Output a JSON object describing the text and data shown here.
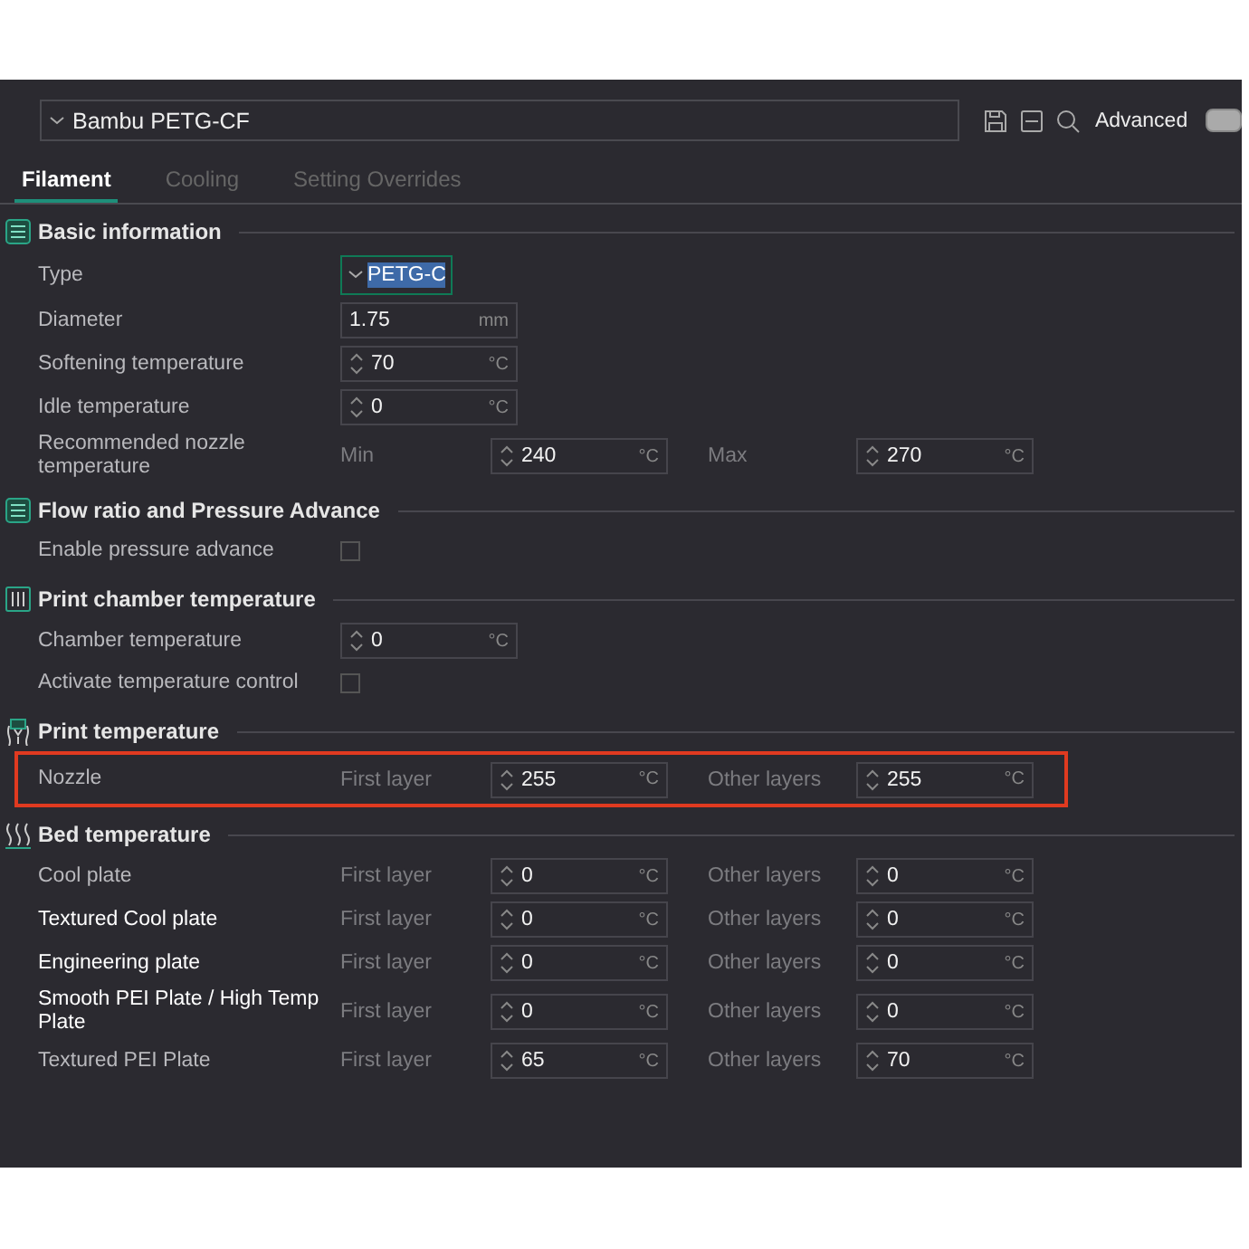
{
  "preset": {
    "value": "Bambu PETG-CF"
  },
  "toolbar": {
    "advanced_label": "Advanced",
    "advanced_on": false
  },
  "tabs": [
    {
      "label": "Filament",
      "selected": true
    },
    {
      "label": "Cooling",
      "selected": false
    },
    {
      "label": "Setting Overrides",
      "selected": false
    }
  ],
  "sections": [
    {
      "title": "Basic information",
      "rows": [
        {
          "kind": "combo",
          "label": "Type",
          "modified": false,
          "value": "PETG-C",
          "focused": true
        },
        {
          "kind": "field",
          "label": "Diameter",
          "modified": false,
          "value": "1.75",
          "unit": "mm",
          "spinner": false
        },
        {
          "kind": "field",
          "label": "Softening temperature",
          "modified": false,
          "value": "70",
          "unit": "°C",
          "spinner": true
        },
        {
          "kind": "field",
          "label": "Idle temperature",
          "modified": false,
          "value": "0",
          "unit": "°C",
          "spinner": true
        },
        {
          "kind": "pair",
          "label": "Recommended nozzle temperature",
          "modified": false,
          "highlighted": false,
          "first_label": "Min",
          "first_value": "240",
          "first_unit": "°C",
          "second_label": "Max",
          "second_value": "270",
          "second_unit": "°C"
        }
      ]
    },
    {
      "title": "Flow ratio and Pressure Advance",
      "rows": [
        {
          "kind": "check",
          "label": "Enable pressure advance",
          "modified": false,
          "checked": false
        }
      ]
    },
    {
      "title": "Print chamber temperature",
      "rows": [
        {
          "kind": "field",
          "label": "Chamber temperature",
          "modified": false,
          "value": "0",
          "unit": "°C",
          "spinner": true
        },
        {
          "kind": "check",
          "label": "Activate temperature control",
          "modified": false,
          "checked": false
        }
      ]
    },
    {
      "title": "Print temperature",
      "rows": [
        {
          "kind": "pair",
          "label": "Nozzle",
          "modified": false,
          "highlighted": true,
          "first_label": "First layer",
          "first_value": "255",
          "first_unit": "°C",
          "second_label": "Other layers",
          "second_value": "255",
          "second_unit": "°C"
        }
      ]
    },
    {
      "title": "Bed temperature",
      "rows": [
        {
          "kind": "pair",
          "label": "Cool plate",
          "modified": false,
          "highlighted": false,
          "first_label": "First layer",
          "first_value": "0",
          "first_unit": "°C",
          "second_label": "Other layers",
          "second_value": "0",
          "second_unit": "°C"
        },
        {
          "kind": "pair",
          "label": "Textured Cool plate",
          "modified": true,
          "highlighted": false,
          "first_label": "First layer",
          "first_value": "0",
          "first_unit": "°C",
          "second_label": "Other layers",
          "second_value": "0",
          "second_unit": "°C"
        },
        {
          "kind": "pair",
          "label": "Engineering plate",
          "modified": true,
          "highlighted": false,
          "first_label": "First layer",
          "first_value": "0",
          "first_unit": "°C",
          "second_label": "Other layers",
          "second_value": "0",
          "second_unit": "°C"
        },
        {
          "kind": "pair",
          "label": "Smooth PEI Plate / High Temp Plate",
          "modified": true,
          "highlighted": false,
          "first_label": "First layer",
          "first_value": "0",
          "first_unit": "°C",
          "second_label": "Other layers",
          "second_value": "0",
          "second_unit": "°C"
        },
        {
          "kind": "pair",
          "label": "Textured PEI Plate",
          "modified": false,
          "highlighted": false,
          "first_label": "First layer",
          "first_value": "65",
          "first_unit": "°C",
          "second_label": "Other layers",
          "second_value": "70",
          "second_unit": "°C"
        }
      ]
    }
  ]
}
